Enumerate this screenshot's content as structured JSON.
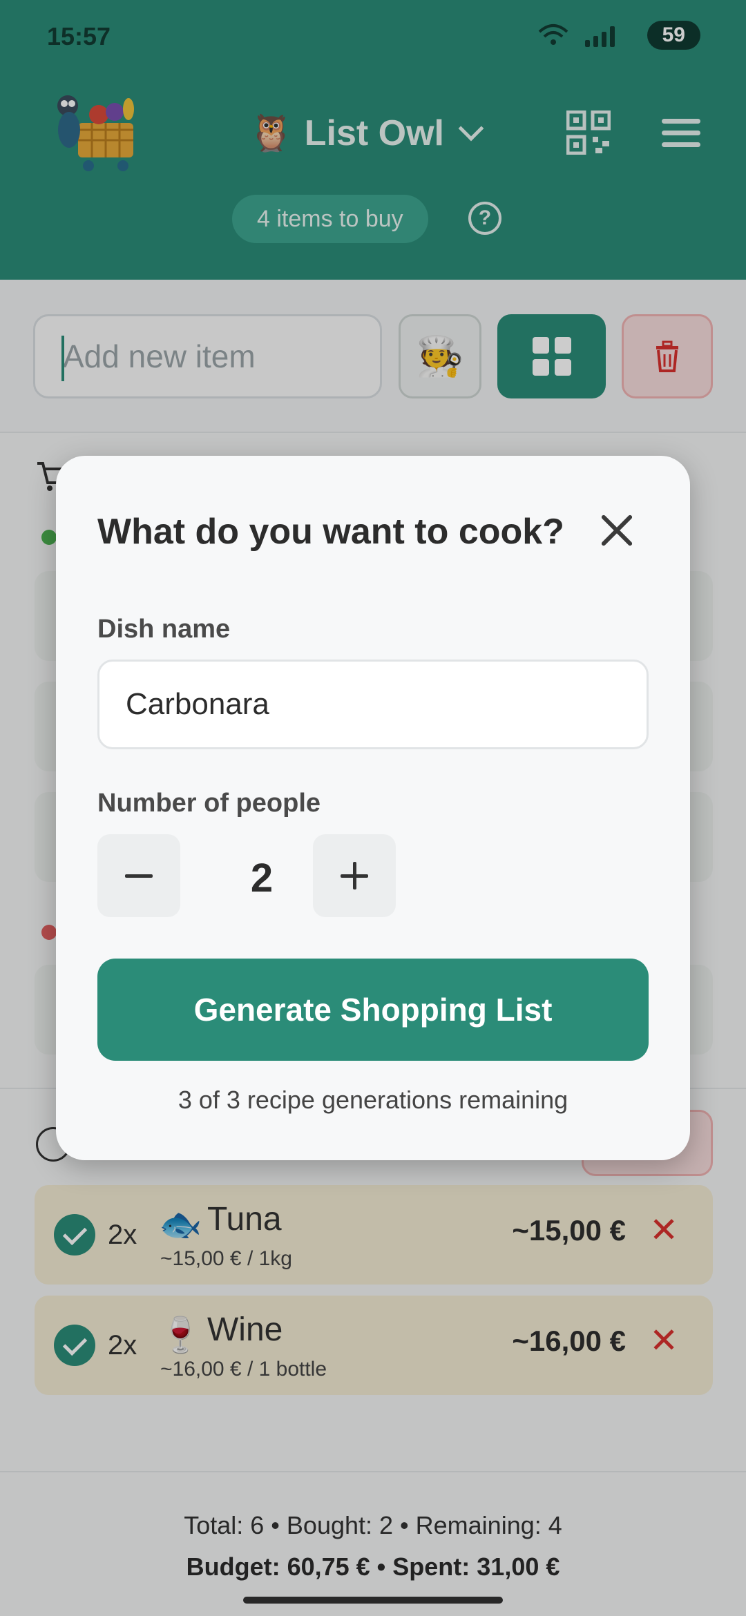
{
  "status_bar": {
    "time": "15:57",
    "battery": "59"
  },
  "header": {
    "app_name": "List Owl",
    "app_emoji": "🦉",
    "items_pill": "4 items to buy",
    "help": "?"
  },
  "add_row": {
    "placeholder": "Add new item",
    "cook_emoji": "🧑‍🍳"
  },
  "bought_items": [
    {
      "qty": "2x",
      "emoji": "🐟",
      "name": "Tuna",
      "unit_price": "~15,00 € / 1kg",
      "total": "~15,00 €",
      "remove": "✕"
    },
    {
      "qty": "2x",
      "emoji": "🍷",
      "name": "Wine",
      "unit_price": "~16,00 € / 1 bottle",
      "total": "~16,00 €",
      "remove": "✕"
    }
  ],
  "footer": {
    "line1": "Total: 6 • Bought: 2 • Remaining: 4",
    "line2": "Budget: 60,75 € • Spent: 31,00 €"
  },
  "modal": {
    "title": "What do you want to cook?",
    "dish_label": "Dish name",
    "dish_value": "Carbonara",
    "people_label": "Number of people",
    "people_count": "2",
    "generate_label": "Generate Shopping List",
    "remaining_text": "3 of 3 recipe generations remaining"
  },
  "colors": {
    "primary": "#2b8c78",
    "danger": "#d9302e",
    "bought_row": "#f3ecd4"
  }
}
